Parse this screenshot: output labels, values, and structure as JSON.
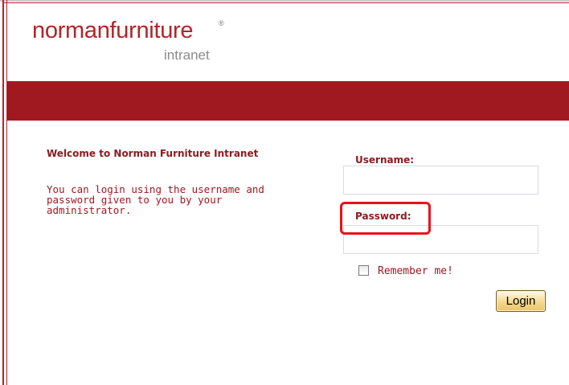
{
  "brand": {
    "logo_main": "normanfurniture",
    "logo_registered": "®",
    "logo_sub": "intranet",
    "colors": {
      "brand_red": "#a01820",
      "label_red": "#8c1a1f",
      "highlight": "#e8111a"
    }
  },
  "welcome": {
    "title": "Welcome to Norman Furniture Intranet",
    "text": "You can login using the username and password given to you by your administrator."
  },
  "login_form": {
    "username_label": "Username:",
    "username_value": "",
    "password_label": "Password:",
    "password_value": "",
    "remember_label": "Remember me!",
    "remember_checked": false,
    "login_button": "Login"
  }
}
